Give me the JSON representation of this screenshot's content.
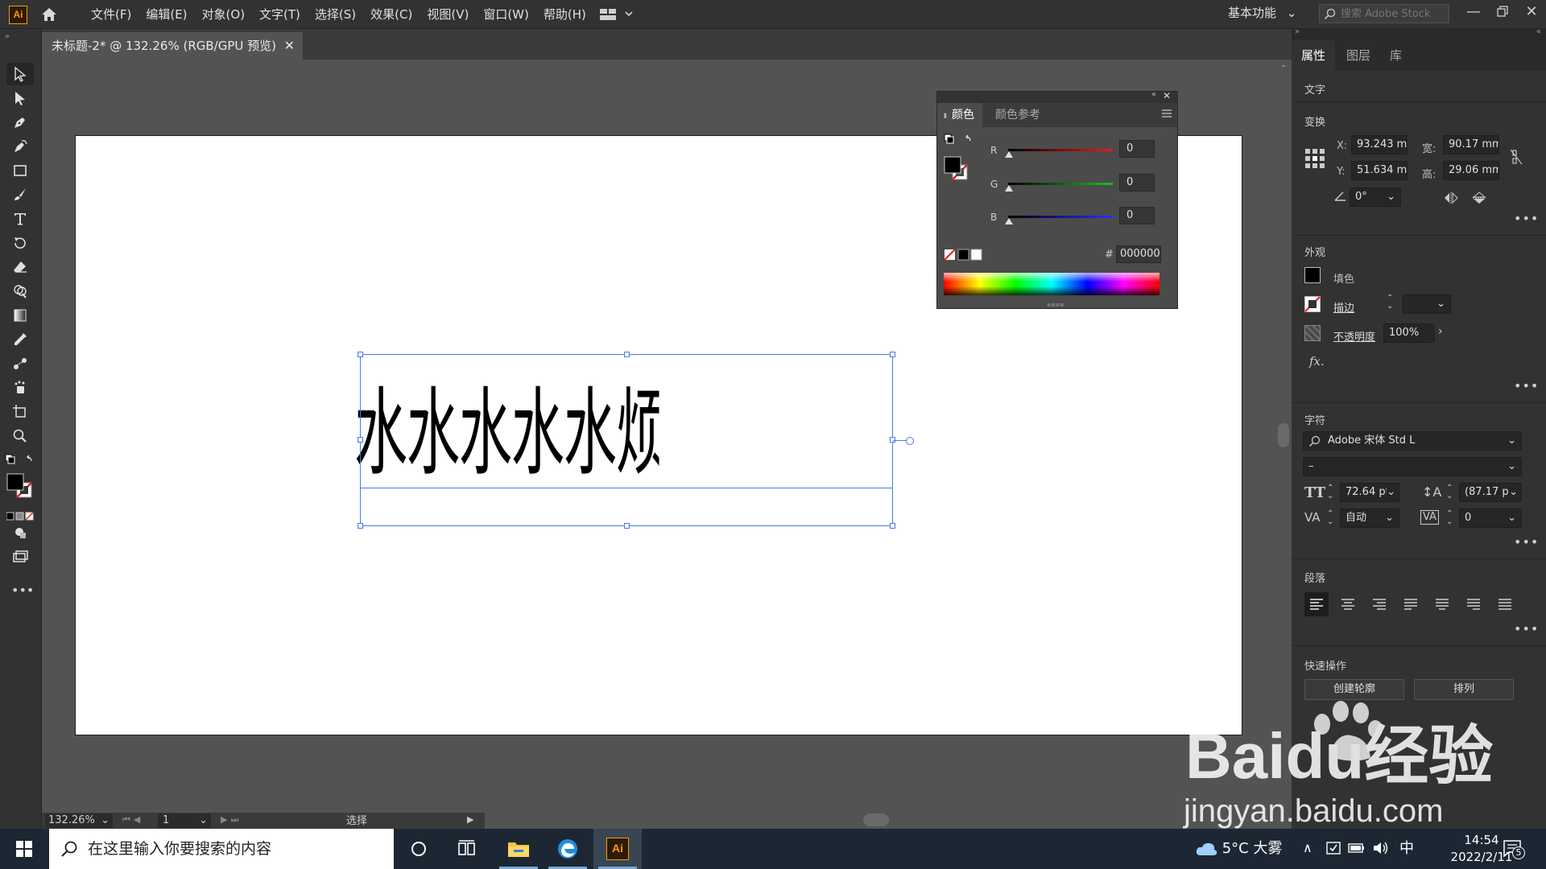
{
  "app": {
    "logo": "Ai",
    "menus": [
      "文件(F)",
      "编辑(E)",
      "对象(O)",
      "文字(T)",
      "选择(S)",
      "效果(C)",
      "视图(V)",
      "窗口(W)",
      "帮助(H)"
    ],
    "workspace": "基本功能",
    "stock_search_placeholder": "搜索 Adobe Stock"
  },
  "document": {
    "tab_title": "未标题-2* @ 132.26% (RGB/GPU 预览)",
    "artwork_text": "水水水水水烦烦烦方法"
  },
  "status": {
    "zoom": "132.26%",
    "page": "1",
    "tool": "选择"
  },
  "color_panel": {
    "tabs": [
      "颜色",
      "颜色参考"
    ],
    "r_label": "R",
    "g_label": "G",
    "b_label": "B",
    "r": "0",
    "g": "0",
    "b": "0",
    "hex_symbol": "#",
    "hex": "000000",
    "colors": {
      "red": "#e81c1c",
      "green": "#1fbf1f",
      "blue": "#2c2cff"
    }
  },
  "properties": {
    "tabs": [
      "属性",
      "图层",
      "库"
    ],
    "object_type": "文字",
    "transform": {
      "title": "变换",
      "x_label": "X:",
      "x": "93.243 mm",
      "y_label": "Y:",
      "y": "51.634 mm",
      "w_label": "宽:",
      "w": "90.17 mm",
      "h_label": "高:",
      "h": "29.06 mm",
      "rotate": "0°"
    },
    "appearance": {
      "title": "外观",
      "fill": "填色",
      "stroke": "描边",
      "opacity_label": "不透明度",
      "opacity": "100%",
      "fx": "fx."
    },
    "character": {
      "title": "字符",
      "font": "Adobe 宋体 Std L",
      "style": "–",
      "size": "72.64 pt",
      "leading": "(87.17 pt)",
      "kerning": "自动",
      "tracking": "0"
    },
    "paragraph": {
      "title": "段落"
    },
    "quick_actions": {
      "title": "快速操作",
      "create_outlines": "创建轮廓",
      "arrange": "排列"
    },
    "more": "•••"
  },
  "watermark": {
    "main": "Baidu经验",
    "sub": "jingyan.baidu.com"
  },
  "taskbar": {
    "search_placeholder": "在这里输入你要搜索的内容",
    "weather": "5°C 大雾",
    "ime": "中",
    "time": "14:54",
    "date": "2022/2/11",
    "notification_count": "5"
  }
}
